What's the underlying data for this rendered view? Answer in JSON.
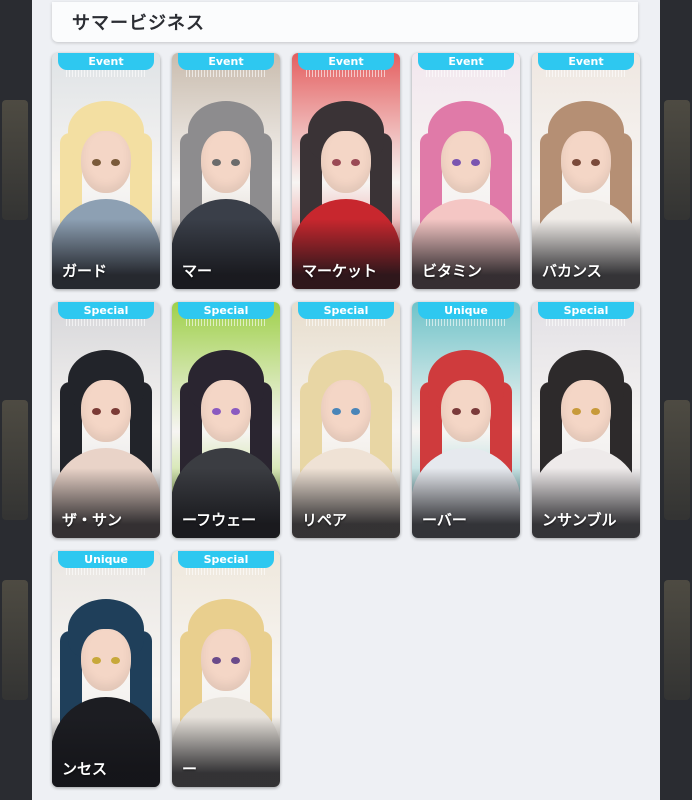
{
  "header": {
    "title": "サマービジネス"
  },
  "cards": [
    {
      "badge": "Event",
      "name": "ガード",
      "bg": "#dfe3e6",
      "hair": "#f3dfa2",
      "eye": "#7a5a3a",
      "outfit": "#8da0b3",
      "accent": "#ffffff"
    },
    {
      "badge": "Event",
      "name": "マー",
      "bg": "#c9bcae",
      "hair": "#8d8c8e",
      "eye": "#6b6b6b",
      "outfit": "#3a3f49",
      "accent": "#d94a45"
    },
    {
      "badge": "Event",
      "name": "マーケット",
      "bg": "#e45f60",
      "hair": "#3a3336",
      "eye": "#9a4a55",
      "outfit": "#c8272e",
      "accent": "#ffffff"
    },
    {
      "badge": "Event",
      "name": "ビタミン",
      "bg": "#f2e7ee",
      "hair": "#e07aa8",
      "eye": "#7a55b0",
      "outfit": "#f4c6c4",
      "accent": "#ffffff"
    },
    {
      "badge": "Event",
      "name": "バカンス",
      "bg": "#efe7e1",
      "hair": "#b58f74",
      "eye": "#7a4a3a",
      "outfit": "#f0ece8",
      "accent": "#3d3a3a"
    },
    {
      "badge": "Special",
      "name": "ザ・サン",
      "bg": "#d6d6d9",
      "hair": "#22242a",
      "eye": "#7a3a35",
      "outfit": "#e9d3c8",
      "accent": "#1e1e22"
    },
    {
      "badge": "Special",
      "name": "ーフウェー",
      "bg": "#9fd04a",
      "hair": "#2a2530",
      "eye": "#8a5ac0",
      "outfit": "#3b3d42",
      "accent": "#7cd03a"
    },
    {
      "badge": "Special",
      "name": "リペア",
      "bg": "#e7ddcc",
      "hair": "#e8d6a4",
      "eye": "#4a85b8",
      "outfit": "#efe2d5",
      "accent": "#8a3a2a"
    },
    {
      "badge": "Unique",
      "name": "ーバー",
      "bg": "#6fc3c9",
      "hair": "#cf3b3d",
      "eye": "#7a3a3a",
      "outfit": "#e6e9ee",
      "accent": "#2a7a8a"
    },
    {
      "badge": "Special",
      "name": "ンサンブル",
      "bg": "#e2e0e5",
      "hair": "#2d2a2b",
      "eye": "#c79a3a",
      "outfit": "#eeeaea",
      "accent": "#5fa8c8"
    },
    {
      "badge": "Unique",
      "name": "ンセス",
      "bg": "#e9e6e2",
      "hair": "#1f3f5a",
      "eye": "#c7a83a",
      "outfit": "#1c1d22",
      "accent": "#ffffff"
    },
    {
      "badge": "Special",
      "name": "ー",
      "bg": "#efe8dc",
      "hair": "#e9cf8e",
      "eye": "#6a4a8a",
      "outfit": "#e7e2db",
      "accent": "#8a5ad0"
    }
  ],
  "colors": {
    "badge": "#2ec8f0",
    "panel": "#eef0f4",
    "title_bar": "#fbfcfd"
  }
}
